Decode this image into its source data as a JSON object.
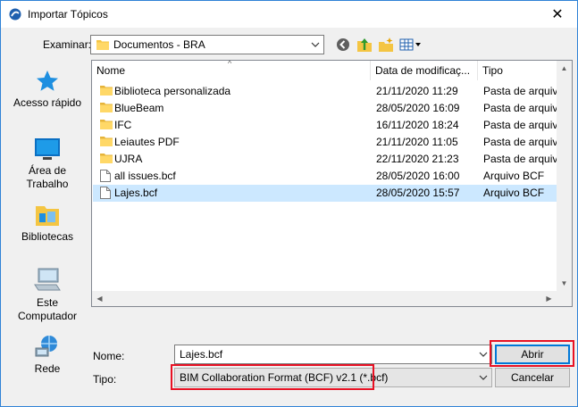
{
  "window": {
    "title": "Importar Tópicos",
    "close_glyph": "✕"
  },
  "toolbar": {
    "lookin_label": "Examinar:",
    "lookin_value": "Documentos - BRA",
    "icons": [
      "back-icon",
      "up-folder-icon",
      "new-folder-icon",
      "view-menu-icon"
    ]
  },
  "places": [
    {
      "label": "Acesso rápido",
      "icon": "star-icon"
    },
    {
      "label": "Área de Trabalho",
      "icon": "desktop-icon"
    },
    {
      "label": "Bibliotecas",
      "icon": "libraries-icon"
    },
    {
      "label": "Este Computador",
      "icon": "computer-icon"
    },
    {
      "label": "Rede",
      "icon": "network-icon"
    }
  ],
  "columns": {
    "name": "Nome",
    "date": "Data de modificaç...",
    "type": "Tipo"
  },
  "files": [
    {
      "name": "Biblioteca personalizada",
      "date": "21/11/2020 11:29",
      "type": "Pasta de arquiv...",
      "kind": "folder"
    },
    {
      "name": "BlueBeam",
      "date": "28/05/2020 16:09",
      "type": "Pasta de arquiv...",
      "kind": "folder"
    },
    {
      "name": "IFC",
      "date": "16/11/2020 18:24",
      "type": "Pasta de arquiv...",
      "kind": "folder"
    },
    {
      "name": "Leiautes PDF",
      "date": "21/11/2020 11:05",
      "type": "Pasta de arquiv...",
      "kind": "folder"
    },
    {
      "name": "UJRA",
      "date": "22/11/2020 21:23",
      "type": "Pasta de arquiv...",
      "kind": "folder"
    },
    {
      "name": "all issues.bcf",
      "date": "28/05/2020 16:00",
      "type": "Arquivo BCF",
      "kind": "file"
    },
    {
      "name": "Lajes.bcf",
      "date": "28/05/2020 15:57",
      "type": "Arquivo BCF",
      "kind": "file",
      "selected": true
    }
  ],
  "bottom": {
    "name_label": "Nome:",
    "name_value": "Lajes.bcf",
    "type_label": "Tipo:",
    "type_value": "BIM Collaboration Format (BCF) v2.1  (*.bcf)",
    "open_button": "Abrir",
    "cancel_button": "Cancelar"
  },
  "colors": {
    "highlight": "#e81123",
    "selection": "#cce8ff",
    "accent": "#0078d7"
  }
}
